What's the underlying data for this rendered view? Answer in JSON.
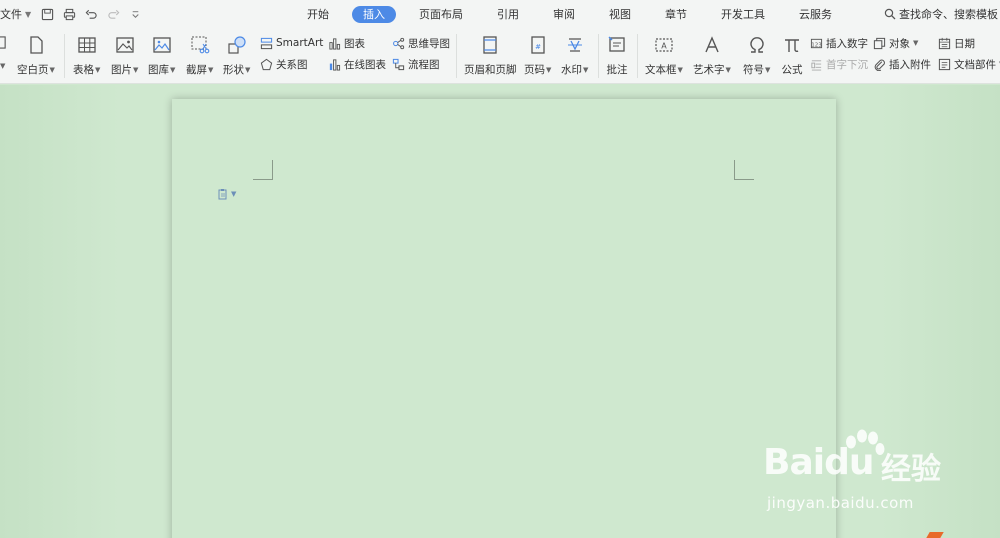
{
  "menubar": {
    "file_label": "文件",
    "tabs": [
      {
        "label": "开始",
        "active": false
      },
      {
        "label": "插入",
        "active": true
      },
      {
        "label": "页面布局",
        "active": false
      },
      {
        "label": "引用",
        "active": false
      },
      {
        "label": "审阅",
        "active": false
      },
      {
        "label": "视图",
        "active": false
      },
      {
        "label": "章节",
        "active": false
      },
      {
        "label": "开发工具",
        "active": false
      },
      {
        "label": "云服务",
        "active": false
      }
    ],
    "search_label": "查找命令、搜索模板"
  },
  "ribbon": {
    "blank_page": "空白页",
    "table": "表格",
    "picture": "图片",
    "gallery": "图库",
    "screenshot": "截屏",
    "shape": "形状",
    "smartart": "SmartArt",
    "relation": "关系图",
    "chart": "图表",
    "online_chart": "在线图表",
    "mindmap": "思维导图",
    "flowchart": "流程图",
    "header_footer": "页眉和页脚",
    "page_number": "页码",
    "watermark": "水印",
    "comment": "批注",
    "textbox": "文本框",
    "wordart": "艺术字",
    "symbol": "符号",
    "formula": "公式",
    "insert_number": "插入数字",
    "drop_cap": "首字下沉",
    "object": "对象",
    "attachment": "插入附件",
    "date": "日期",
    "doc_parts": "文档部件"
  },
  "watermark": {
    "logo": "Bai",
    "logo_tail": "du",
    "cn": "经验",
    "url": "jingyan.baidu.com"
  },
  "colors": {
    "accent": "#4d8ae6",
    "eye_green": "#cfe8cf",
    "chrome": "#f3f5f4"
  }
}
